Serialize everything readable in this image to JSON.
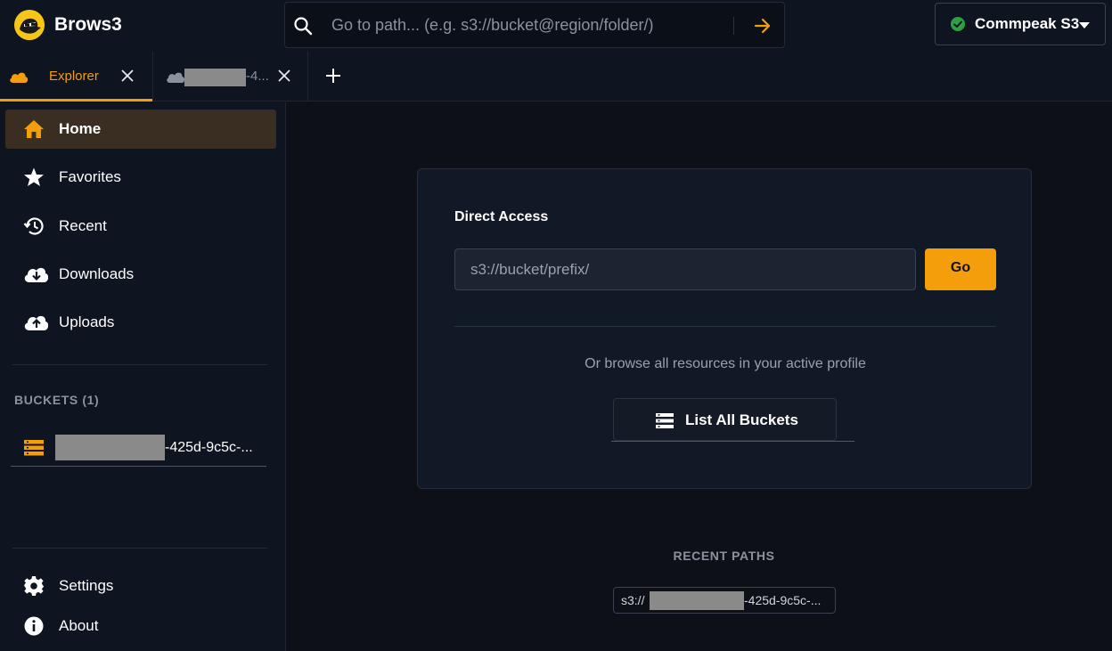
{
  "app": {
    "title": "Brows3",
    "logo_icon": "duck-logo-icon"
  },
  "search": {
    "placeholder": "Go to path... (e.g. s3://bucket@region/folder/)"
  },
  "profile": {
    "name": "Commpeak S3",
    "status_color": "#2ea043"
  },
  "tabs": [
    {
      "label": "Explorer",
      "icon": "cloud-icon",
      "active": true
    },
    {
      "label": "-4...",
      "icon": "cloud-icon",
      "active": false
    }
  ],
  "sidebar": {
    "items": [
      {
        "label": "Home",
        "icon": "home-icon",
        "active": true
      },
      {
        "label": "Favorites",
        "icon": "star-icon"
      },
      {
        "label": "Recent",
        "icon": "history-icon"
      },
      {
        "label": "Downloads",
        "icon": "cloud-download-icon"
      },
      {
        "label": "Uploads",
        "icon": "cloud-upload-icon"
      }
    ],
    "buckets_heading": "BUCKETS (1)",
    "buckets": [
      {
        "label": "-425d-9c5c-...",
        "icon": "bucket-storage-icon"
      }
    ],
    "footer_items": [
      {
        "label": "Settings",
        "icon": "gear-icon"
      },
      {
        "label": "About",
        "icon": "info-icon"
      }
    ]
  },
  "main": {
    "direct_access": {
      "title": "Direct Access",
      "input_placeholder": "s3://bucket/prefix/",
      "go_label": "Go"
    },
    "browse_text": "Or browse all resources in your active profile",
    "list_all_label": "List All Buckets",
    "recent_heading": "RECENT PATHS",
    "recent_paths": [
      {
        "prefix": "s3://",
        "suffix": "-425d-9c5c-..."
      }
    ]
  },
  "colors": {
    "accent": "#f59e0b",
    "background": "#0d1117",
    "panel": "#0e1420"
  }
}
